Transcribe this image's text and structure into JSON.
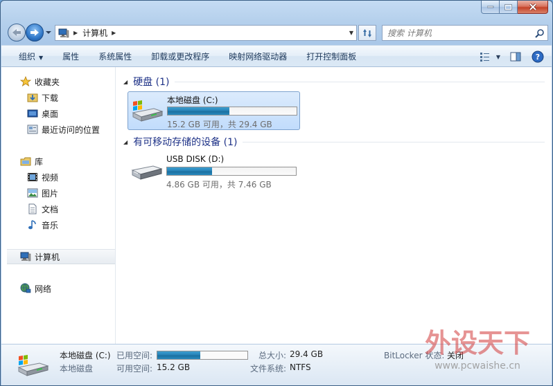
{
  "window": {
    "controls": {
      "minimize": "minimize",
      "maximize": "maximize",
      "close": "close"
    }
  },
  "navigation": {
    "breadcrumb": [
      "计算机"
    ],
    "search_placeholder": "搜索 计算机"
  },
  "toolbar": {
    "items": [
      "组织",
      "属性",
      "系统属性",
      "卸载或更改程序",
      "映射网络驱动器",
      "打开控制面板"
    ]
  },
  "sidebar": {
    "favorites": {
      "label": "收藏夹",
      "items": [
        "下载",
        "桌面",
        "最近访问的位置"
      ]
    },
    "libraries": {
      "label": "库",
      "items": [
        "视频",
        "图片",
        "文档",
        "音乐"
      ]
    },
    "computer": {
      "label": "计算机"
    },
    "network": {
      "label": "网络"
    }
  },
  "groups": [
    {
      "title": "硬盘 (1)",
      "drives": [
        {
          "name": "本地磁盘 (C:)",
          "free_text": "15.2 GB 可用，共 29.4 GB",
          "used_fraction": 0.48,
          "selected": true
        }
      ]
    },
    {
      "title": "有可移动存储的设备 (1)",
      "drives": [
        {
          "name": "USB DISK (D:)",
          "free_text": "4.86 GB 可用，共 7.46 GB",
          "used_fraction": 0.35,
          "selected": false
        }
      ]
    }
  ],
  "details": {
    "name": "本地磁盘 (C:)",
    "type": "本地磁盘",
    "used_label": "已用空间:",
    "used_fraction": 0.48,
    "free_label": "可用空间:",
    "free_value": "15.2 GB",
    "total_label": "总大小:",
    "total_value": "29.4 GB",
    "fs_label": "文件系统:",
    "fs_value": "NTFS",
    "bitlocker_label": "BitLocker 状态:",
    "bitlocker_value": "关闭"
  },
  "watermark": {
    "text": "外设天下",
    "url": "www.pcwaishe.cn"
  },
  "colors": {
    "accent": "#1e3287",
    "bar_fill": "#2883b8",
    "selection": "#c1dcfc"
  }
}
